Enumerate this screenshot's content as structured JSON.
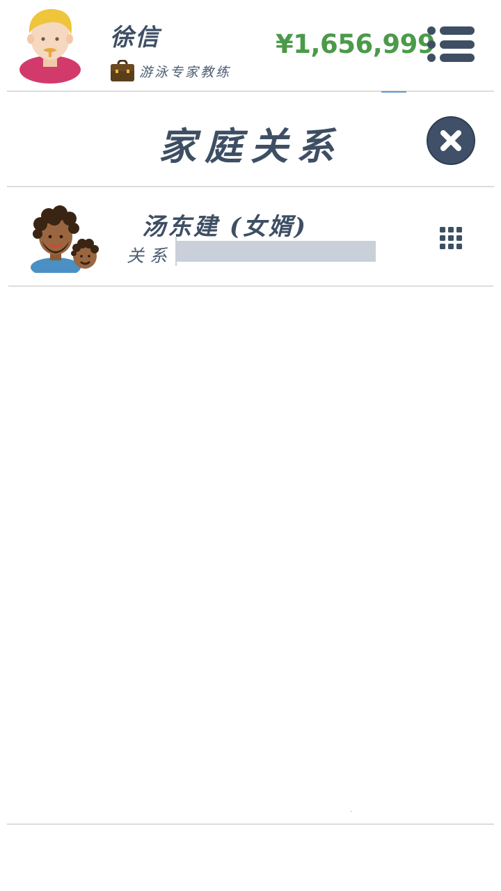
{
  "header": {
    "player_name": "徐信",
    "job_title": "游泳专家教练",
    "money": "¥1,656,999"
  },
  "panel": {
    "title": "家庭关系"
  },
  "relatives": [
    {
      "name": "汤东建 (女婿)",
      "relation_label": "关系",
      "relation_level": 0
    }
  ],
  "icons": {
    "player": "avatar-blonde-man-icon",
    "job": "briefcase-icon",
    "menu": "list-menu-icon",
    "close": "close-x-icon",
    "relative": "avatar-curly-hair-father-son-icon",
    "options": "grid-dots-icon"
  },
  "colors": {
    "money": "#4b9a4a",
    "text": "#3e4f64",
    "relation_bar": "#c9d0da",
    "close_button": "#3f5068"
  }
}
